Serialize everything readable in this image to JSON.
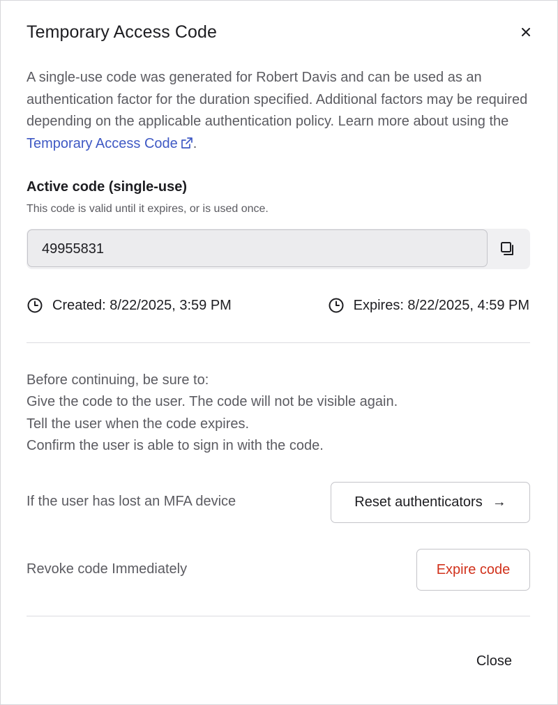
{
  "dialog": {
    "title": "Temporary Access Code",
    "close_icon": "close-icon"
  },
  "description": {
    "text_before": "A single-use code was generated for Robert Davis and can be used as an authentication factor for the duration specified. Additional factors may be required depending on the applicable authentication policy. Learn more about using the ",
    "link_label": "Temporary Access Code",
    "link_icon": "external-link-icon",
    "text_after": "."
  },
  "code_section": {
    "label": "Active code (single-use)",
    "help": "This code is valid until it expires, or is used once.",
    "value": "49955831",
    "copy_icon": "copy-icon"
  },
  "times": {
    "created": "Created: 8/22/2025, 3:59 PM",
    "expires": "Expires: 8/22/2025, 4:59 PM",
    "icon": "clock-icon"
  },
  "instructions": [
    "Before continuing, be sure to:",
    "Give the code to the user. The code will not be visible again.",
    "Tell the user when the code expires.",
    "Confirm the user is able to sign in with the code."
  ],
  "reset": {
    "label": "If the user has lost an MFA device",
    "button_label": "Reset authenticators",
    "button_icon": "→"
  },
  "revoke": {
    "label": "Revoke code Immediately",
    "button_label": "Expire code"
  },
  "footer": {
    "close_label": "Close"
  },
  "colors": {
    "link": "#3f59c4",
    "danger": "#d1321c",
    "muted_text": "#5b5b61"
  }
}
